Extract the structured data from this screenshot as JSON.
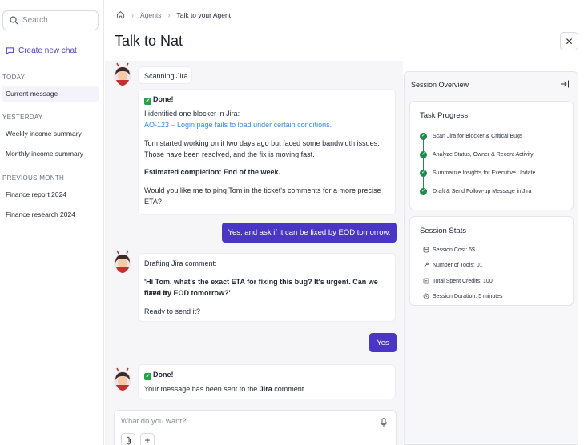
{
  "sidebar": {
    "search_placeholder": "Search",
    "new_chat": "Create new chat",
    "sections": [
      {
        "title": "TODAY",
        "items": [
          "Current message"
        ]
      },
      {
        "title": "YESTERDAY",
        "items": [
          "Weekly income summary",
          "Monthly income summary"
        ]
      },
      {
        "title": "PREVIOUS MONTH",
        "items": [
          "Finance report 2024",
          "Finance research 2024"
        ]
      }
    ]
  },
  "breadcrumb": {
    "agents": "Agents",
    "current": "Talk to your Agent"
  },
  "page_title": "Talk to Nat",
  "chat": {
    "scanning": "Scanning Jira",
    "done1": "Done!",
    "blocker_intro": "I identified one blocker in Jira:",
    "blocker_link": "AO-123 – Login page fails to load under certain conditions.",
    "tom_line1": "Tom started working on it two days ago but faced some bandwidth issues.",
    "tom_line2": "Those have been resolved, and the fix is moving fast.",
    "estimated": "Estimated completion: End of the week.",
    "ping_line1": "Would you like me to ping Tom in the ticket's comments for a more precise",
    "ping_line2": "ETA?",
    "user_msg1": "Yes, and ask if it can be fixed by EOD tomorrow.",
    "drafting": "Drafting Jira comment:",
    "draft_line1": "'Hi Tom, what's the exact ETA for fixing this bug? It's urgent. Can we have it",
    "draft_line2": "fixed by EOD tomorrow?'",
    "ready": "Ready to send it?",
    "user_msg2": "Yes",
    "done2": "Done!",
    "sent_pre": "Your message has been sent to the ",
    "sent_bold": "Jira",
    "sent_post": " comment.",
    "input_placeholder": "What do you want?"
  },
  "panel": {
    "title": "Session Overview",
    "task_progress_title": "Task Progress",
    "steps": [
      "Scan Jira for Blocker & Critical Bugs",
      "Analyze Status, Owner & Recent Activity",
      "Summarize Insights for Executive Update",
      "Draft & Send Follow-up Message in Jira"
    ],
    "stats_title": "Session Stats",
    "stats": [
      {
        "icon": "coin-icon",
        "text": "Session Cost:  5$"
      },
      {
        "icon": "wrench-icon",
        "text": "Number of Tools: 01"
      },
      {
        "icon": "credits-icon",
        "text": "Total Spent Credits: 100"
      },
      {
        "icon": "clock-icon",
        "text": "Session Duration: 5 minutes"
      }
    ]
  },
  "colors": {
    "accent": "#4a36c4",
    "success": "#1f8a4c",
    "link": "#3b82f6"
  }
}
